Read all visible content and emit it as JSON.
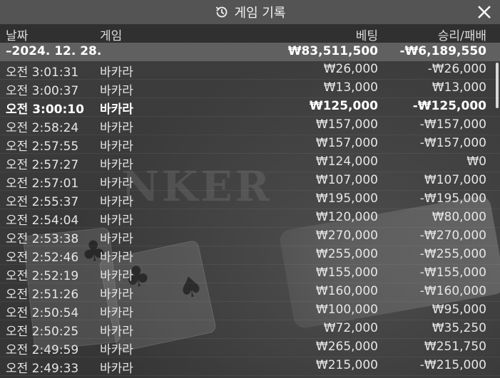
{
  "header": {
    "title": "게임 기록",
    "history_icon": "history-icon",
    "close_icon": "close-icon"
  },
  "columns": {
    "date": "날짜",
    "game": "게임",
    "bet": "베팅",
    "result": "승리/패배"
  },
  "summary": {
    "date": "–2024. 12. 28.",
    "bet": "₩83,511,500",
    "result": "-₩6,189,550"
  },
  "rows": [
    {
      "time": "오전 3:01:31",
      "game": "바카라",
      "bet": "₩26,000",
      "result": "-₩26,000"
    },
    {
      "time": "오전 3:00:37",
      "game": "바카라",
      "bet": "₩13,000",
      "result": "₩13,000"
    },
    {
      "time": "오전 3:00:10",
      "game": "바카라",
      "bet": "₩125,000",
      "result": "-₩125,000"
    },
    {
      "time": "오전 2:58:24",
      "game": "바카라",
      "bet": "₩157,000",
      "result": "-₩157,000"
    },
    {
      "time": "오전 2:57:55",
      "game": "바카라",
      "bet": "₩157,000",
      "result": "-₩157,000"
    },
    {
      "time": "오전 2:57:27",
      "game": "바카라",
      "bet": "₩124,000",
      "result": "₩0"
    },
    {
      "time": "오전 2:57:01",
      "game": "바카라",
      "bet": "₩107,000",
      "result": "₩107,000"
    },
    {
      "time": "오전 2:55:37",
      "game": "바카라",
      "bet": "₩195,000",
      "result": "-₩195,000"
    },
    {
      "time": "오전 2:54:04",
      "game": "바카라",
      "bet": "₩120,000",
      "result": "₩80,000"
    },
    {
      "time": "오전 2:53:38",
      "game": "바카라",
      "bet": "₩270,000",
      "result": "-₩270,000"
    },
    {
      "time": "오전 2:52:46",
      "game": "바카라",
      "bet": "₩255,000",
      "result": "-₩255,000"
    },
    {
      "time": "오전 2:52:19",
      "game": "바카라",
      "bet": "₩155,000",
      "result": "-₩155,000"
    },
    {
      "time": "오전 2:51:26",
      "game": "바카라",
      "bet": "₩160,000",
      "result": "-₩160,000"
    },
    {
      "time": "오전 2:50:54",
      "game": "바카라",
      "bet": "₩100,000",
      "result": "₩95,000"
    },
    {
      "time": "오전 2:50:25",
      "game": "바카라",
      "bet": "₩72,000",
      "result": "₩35,250"
    },
    {
      "time": "오전 2:49:59",
      "game": "바카라",
      "bet": "₩265,000",
      "result": "₩251,750"
    },
    {
      "time": "오전 2:49:33",
      "game": "바카라",
      "bet": "₩215,000",
      "result": "-₩215,000"
    }
  ],
  "background": {
    "table_text": "NKER"
  },
  "colors": {
    "header_bg": "#545454",
    "summary_bg": "#8c8c8c",
    "text": "#e6e6e6"
  }
}
